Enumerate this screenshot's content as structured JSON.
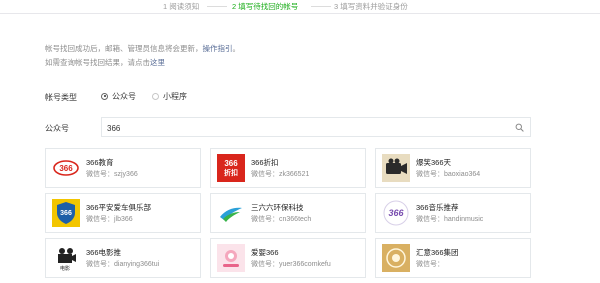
{
  "steps": [
    {
      "label": "1 阅读须知",
      "active": false
    },
    {
      "label": "2 填写待找回的帐号",
      "active": true
    },
    {
      "label": "3 填写资料并验证身份",
      "active": false
    }
  ],
  "notice": {
    "line1_text": "帐号找回成功后，邮箱、管理员信息将会更新，",
    "line1_link": "操作指引",
    "line1_end": "。",
    "line2_text": "如需查询帐号找回结果，请点击",
    "line2_link": "这里"
  },
  "account_type": {
    "label": "帐号类型",
    "options": [
      {
        "label": "公众号",
        "checked": true
      },
      {
        "label": "小程序",
        "checked": false
      }
    ]
  },
  "search": {
    "label": "公众号",
    "value": "366",
    "icon": "search-icon"
  },
  "results": [
    {
      "name": "366教育",
      "wxid_label": "微信号：",
      "wxid": "szjy366",
      "icon": "logo-366-education"
    },
    {
      "name": "366折扣",
      "wxid_label": "微信号：",
      "wxid": "zk366521",
      "icon": "logo-366-discount",
      "logo_text_top": "366",
      "logo_text_bottom": "折扣"
    },
    {
      "name": "爆笑366天",
      "wxid_label": "微信号：",
      "wxid": "baoxiao364",
      "icon": "logo-camera"
    },
    {
      "name": "366平安爱车俱乐部",
      "wxid_label": "微信号：",
      "wxid": "jlb366",
      "icon": "logo-car-club",
      "logo_text": "366"
    },
    {
      "name": "三六六环保科技",
      "wxid_label": "微信号：",
      "wxid": "cn366tech",
      "icon": "logo-eco-tech"
    },
    {
      "name": "366音乐推荐",
      "wxid_label": "微信号：",
      "wxid": "handinmusic",
      "icon": "logo-366-music",
      "logo_text": "366"
    },
    {
      "name": "366电影推",
      "wxid_label": "微信号：",
      "wxid": "dianying366tui",
      "icon": "logo-movie",
      "logo_text": "电影"
    },
    {
      "name": "爱婴366",
      "wxid_label": "微信号：",
      "wxid": "yuer366comkefu",
      "icon": "logo-baby"
    },
    {
      "name": "汇意366集团",
      "wxid_label": "微信号：",
      "wxid": "",
      "icon": "logo-group"
    }
  ],
  "colors": {
    "accent_green": "#1aad19",
    "link_blue": "#576b95",
    "border": "#e4e8eb"
  }
}
